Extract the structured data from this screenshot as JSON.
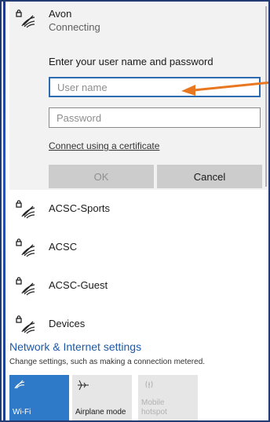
{
  "network_list": {
    "connecting": {
      "name": "Avon",
      "status": "Connecting",
      "prompt": "Enter your user name and password",
      "username_placeholder": "User name",
      "password_placeholder": "Password",
      "cert_link": "Connect using a certificate",
      "ok_label": "OK",
      "cancel_label": "Cancel"
    },
    "items": [
      {
        "name": "ACSC-Sports"
      },
      {
        "name": "ACSC"
      },
      {
        "name": "ACSC-Guest"
      },
      {
        "name": "Devices"
      }
    ]
  },
  "settings": {
    "title": "Network & Internet settings",
    "description": "Change settings, such as making a connection metered."
  },
  "quick_actions": {
    "wifi": {
      "label": "Wi-Fi",
      "icon": "wifi-icon",
      "active": true
    },
    "airplane": {
      "label": "Airplane mode",
      "icon": "airplane-icon",
      "active": false
    },
    "hotspot": {
      "label_line1": "Mobile",
      "label_line2": "hotspot",
      "icon": "hotspot-icon",
      "active": false
    }
  },
  "colors": {
    "accent": "#2f79c9",
    "link": "#1d58a8",
    "annotation_arrow": "#e8771f",
    "focus_border": "#2d6ab0"
  }
}
